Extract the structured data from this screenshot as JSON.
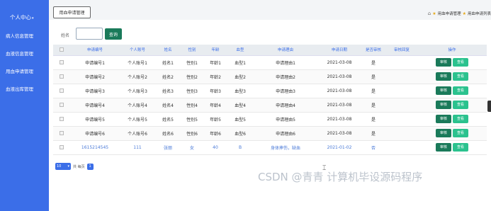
{
  "sidebar": {
    "items": [
      {
        "label": "个人中心",
        "caret": "▾"
      },
      {
        "label": "病人信息管理"
      },
      {
        "label": "血液信息管理"
      },
      {
        "label": "用血申请管理"
      },
      {
        "label": "血液出库管理"
      }
    ]
  },
  "topbar": {
    "tab_label": "用血申请管理",
    "breadcrumb": [
      "用血申请管理",
      "用血申请列表"
    ]
  },
  "search": {
    "label": "姓名",
    "placeholder": "",
    "button_label": "查询"
  },
  "table": {
    "headers": [
      "",
      "申请编号",
      "个人账号",
      "姓名",
      "性别",
      "年龄",
      "血型",
      "申请理由",
      "申请日期",
      "是否审核",
      "审核回复",
      "操作"
    ],
    "rows": [
      [
        "申请编号1",
        "个人账号1",
        "姓名1",
        "性别1",
        "年龄1",
        "血型1",
        "申请理由1",
        "2021-03-08",
        "是",
        ""
      ],
      [
        "申请编号2",
        "个人账号2",
        "姓名2",
        "性别2",
        "年龄2",
        "血型2",
        "申请理由2",
        "2021-03-08",
        "是",
        ""
      ],
      [
        "申请编号3",
        "个人账号3",
        "姓名3",
        "性别3",
        "年龄3",
        "血型3",
        "申请理由3",
        "2021-03-08",
        "是",
        ""
      ],
      [
        "申请编号4",
        "个人账号4",
        "姓名4",
        "性别4",
        "年龄4",
        "血型4",
        "申请理由4",
        "2021-03-08",
        "是",
        ""
      ],
      [
        "申请编号5",
        "个人账号5",
        "姓名5",
        "性别5",
        "年龄5",
        "血型5",
        "申请理由5",
        "2021-03-08",
        "是",
        ""
      ],
      [
        "申请编号6",
        "个人账号6",
        "姓名6",
        "性别6",
        "年龄6",
        "血型6",
        "申请理由6",
        "2021-03-08",
        "是",
        ""
      ],
      [
        "1615214545",
        "111",
        "张丽",
        "女",
        "40",
        "B",
        "身体摔伤，缺血",
        "2021-01-02",
        "否",
        ""
      ]
    ],
    "op_audit": "审核",
    "op_view": "查看"
  },
  "pager": {
    "page_size": "10",
    "total_text": "共 每页",
    "current_page": "1"
  },
  "watermark": "CSDN @青青 计算机毕设源码程序",
  "colors": {
    "sidebar": "#3b6ee8",
    "primary_button": "#1a7a5a",
    "view_button": "#2bc28e",
    "header_text": "#3b6ee8"
  }
}
